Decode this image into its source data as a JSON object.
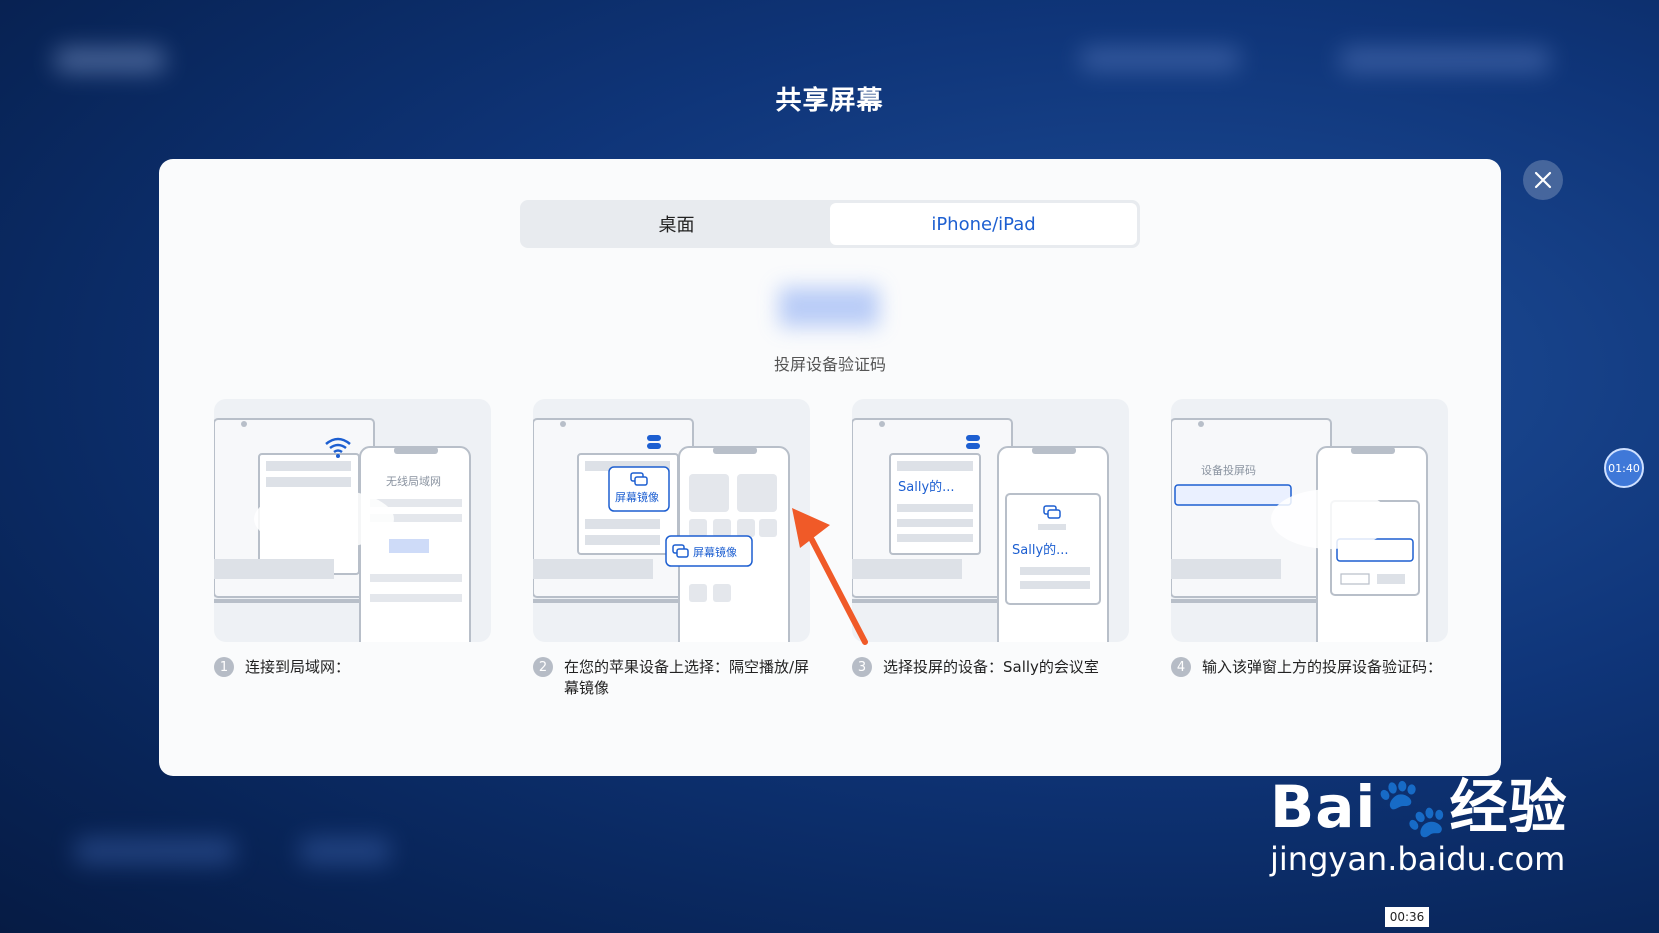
{
  "page_title": "共享屏幕",
  "tabs": [
    {
      "label": "桌面",
      "active": false
    },
    {
      "label": "iPhone/iPad",
      "active": true
    }
  ],
  "code_label": "投屏设备验证码",
  "cards": {
    "c1_phone_label": "无线局域网",
    "c2_mirror_label": "屏幕镜像",
    "c3_device": "Sally的...",
    "c4_code_label": "设备投屏码"
  },
  "steps": [
    {
      "num": "1",
      "text": "连接到局域网："
    },
    {
      "num": "2",
      "text": "在您的苹果设备上选择：隔空播放/屏幕镜像"
    },
    {
      "num": "3",
      "text": "选择投屏的设备：Sally的会议室"
    },
    {
      "num": "4",
      "text": "输入该弹窗上方的投屏设备验证码："
    }
  ],
  "timer": "01:40",
  "watermark": {
    "main": "Bai🐾经验",
    "sub": "jingyan.baidu.com"
  },
  "time_badge": "00:36",
  "colors": {
    "accent": "#1d5fd1",
    "arrow": "#f05a28",
    "background": "#0f3579"
  }
}
